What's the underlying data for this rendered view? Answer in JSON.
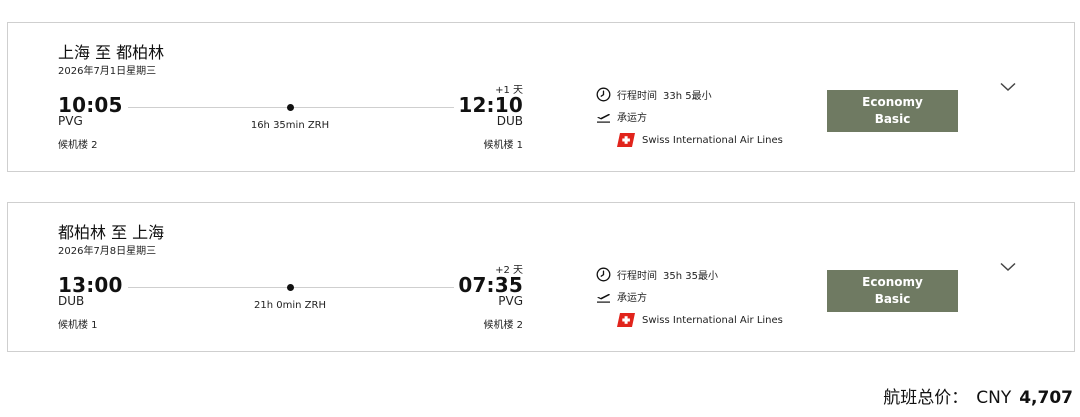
{
  "flights": [
    {
      "route": "上海 至 都柏林",
      "date": "2026年7月1日星期三",
      "departure": {
        "time": "10:05",
        "code": "PVG",
        "terminal": "候机楼 2"
      },
      "stop": "16h 35min ZRH",
      "arrival": {
        "day_offset": "+1 天",
        "time": "12:10",
        "code": "DUB",
        "terminal": "候机楼 1"
      },
      "duration_label": "行程时间",
      "duration_value": "33h 5最小",
      "operator_label": "承运方",
      "airline": "Swiss International Air Lines",
      "fare_line1": "Economy",
      "fare_line2": "Basic"
    },
    {
      "route": "都柏林 至 上海",
      "date": "2026年7月8日星期三",
      "departure": {
        "time": "13:00",
        "code": "DUB",
        "terminal": "候机楼 1"
      },
      "stop": "21h 0min ZRH",
      "arrival": {
        "day_offset": "+2 天",
        "time": "07:35",
        "code": "PVG",
        "terminal": "候机楼 2"
      },
      "duration_label": "行程时间",
      "duration_value": "35h 35最小",
      "operator_label": "承运方",
      "airline": "Swiss International Air Lines",
      "fare_line1": "Economy",
      "fare_line2": "Basic"
    }
  ],
  "total": {
    "label": "航班总价：",
    "currency": "CNY",
    "amount": "4,707"
  },
  "colors": {
    "fare_button": "#6f7a62",
    "swiss_red": "#e1241c",
    "border": "#cfcfcf"
  },
  "icons": [
    "clock-icon",
    "plane-takeoff-icon",
    "swiss-airline-logo",
    "chevron-down-icon"
  ]
}
